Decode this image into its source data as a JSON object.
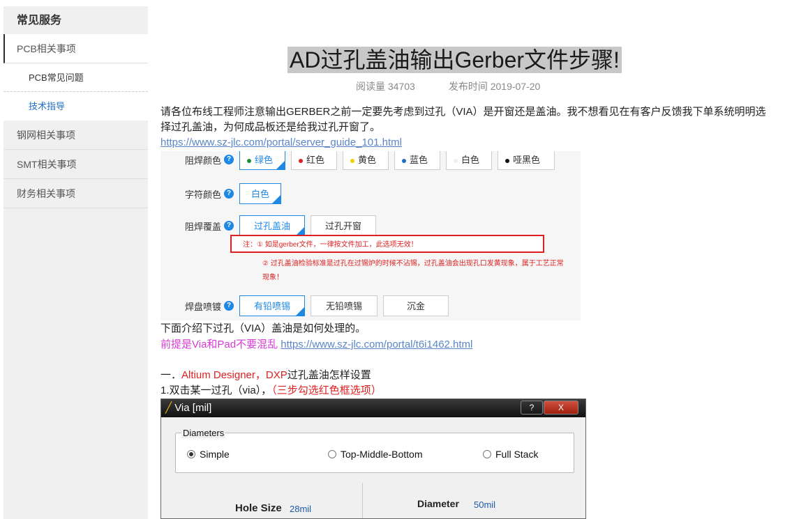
{
  "sidebar": {
    "title": "常见服务",
    "items": [
      {
        "label": "PCB相关事项"
      },
      {
        "label": "PCB常见问题"
      },
      {
        "label": "技术指导"
      },
      {
        "label": "钢网相关事项"
      },
      {
        "label": "SMT相关事项"
      },
      {
        "label": "财务相关事项"
      }
    ]
  },
  "article": {
    "title": "AD过孔盖油输出Gerber文件步骤!",
    "reads": "阅读量 34703",
    "published": "发布时间 2019-07-20",
    "intro": "请各位布线工程师注意输出GERBER之前一定要先考虑到过孔（VIA）是开窗还是盖油。我不想看见在有客户反馈我下单系统明明选择过孔盖油，为何成品板还是给我过孔开窗了。",
    "link1": "https://www.sz-jlc.com/portal/server_guide_101.html",
    "via_intro": "下面介绍下过孔（VIA）盖油是如何处理的。",
    "premise": "前提是Via和Pad不要混乱",
    "link2": "https://www.sz-jlc.com/portal/t6i1462.html",
    "section1_prefix": "一．",
    "section1_red": "Altium Designer，DXP",
    "section1_suffix": "过孔盖油怎样设置",
    "step1_prefix": "1.双击某一过孔（via），",
    "step1_red": "（三步勾选红色框选项）"
  },
  "form_image": {
    "solder_color_label": "阻焊颜色",
    "solder_colors": [
      {
        "label": "绿色",
        "color": "#1a8f3a",
        "selected": true
      },
      {
        "label": "红色",
        "color": "#e02020",
        "selected": false
      },
      {
        "label": "黄色",
        "color": "#f0d000",
        "selected": false
      },
      {
        "label": "蓝色",
        "color": "#1e6fc7",
        "selected": false
      },
      {
        "label": "白色",
        "color": "#eeeeee",
        "selected": false
      },
      {
        "label": "哑黑色",
        "color": "#111111",
        "selected": false
      }
    ],
    "silk_color_label": "字符颜色",
    "silk_colors": [
      {
        "label": "白色",
        "selected": true
      }
    ],
    "cover_label": "阻焊覆盖",
    "cover_options": [
      {
        "label": "过孔盖油",
        "selected": true
      },
      {
        "label": "过孔开窗",
        "selected": false
      }
    ],
    "note1": "注：① 如是gerber文件，一律按文件加工，此选项无效！",
    "note2": "② 过孔盖油检验标准是过孔在过锡炉的时候不沾锡，过孔盖油会出现孔口发黄现象，属于工艺正常现象！",
    "finish_label": "焊盘喷镀",
    "finish_options": [
      {
        "label": "有铅喷锡",
        "selected": true
      },
      {
        "label": "无铅喷锡",
        "selected": false
      },
      {
        "label": "沉金",
        "selected": false
      }
    ],
    "help_icon": "question-circle-icon"
  },
  "dialog_image": {
    "title": "Via [mil]",
    "help_btn": "?",
    "close_btn": "X",
    "group_label": "Diameters",
    "radios": [
      {
        "label": "Simple",
        "checked": true
      },
      {
        "label": "Top-Middle-Bottom",
        "checked": false
      },
      {
        "label": "Full Stack",
        "checked": false
      }
    ],
    "hole_size_label": "Hole Size",
    "hole_size_value": "28mil",
    "diameter_label": "Diameter",
    "diameter_value": "50mil"
  }
}
